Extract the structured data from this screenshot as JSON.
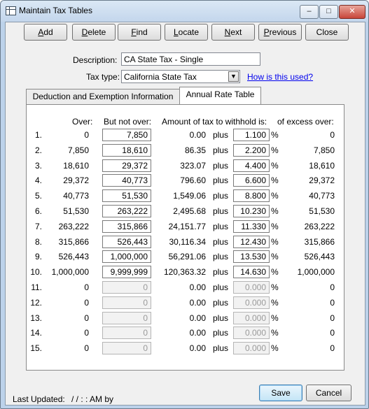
{
  "window": {
    "title": "Maintain Tax Tables"
  },
  "toolbar": {
    "buttons": [
      {
        "pre": "",
        "u": "A",
        "post": "dd"
      },
      {
        "pre": "",
        "u": "D",
        "post": "elete"
      },
      {
        "pre": "",
        "u": "F",
        "post": "ind"
      },
      {
        "pre": "",
        "u": "L",
        "post": "ocate"
      },
      {
        "pre": "",
        "u": "N",
        "post": "ext"
      },
      {
        "pre": "",
        "u": "P",
        "post": "revious"
      },
      {
        "pre": "Close",
        "u": "",
        "post": ""
      }
    ]
  },
  "form": {
    "description_label": "Description:",
    "description_value": "CA State Tax - Single",
    "taxtype_label": "Tax type:",
    "taxtype_value": "California State Tax",
    "help_link": "How is this used?"
  },
  "tabs": [
    "Deduction and Exemption Information",
    "Annual Rate Table"
  ],
  "table": {
    "headers": {
      "over": "Over:",
      "not_over": "But not over:",
      "amount": "Amount of tax to withhold is:",
      "excess": "of excess over:"
    },
    "rows": [
      {
        "n": "1.",
        "over": "0",
        "not_over": "7,850",
        "amount": "0.00",
        "plus": "plus",
        "rate": "1.100",
        "pct": "%",
        "excess": "0",
        "enabled": true
      },
      {
        "n": "2.",
        "over": "7,850",
        "not_over": "18,610",
        "amount": "86.35",
        "plus": "plus",
        "rate": "2.200",
        "pct": "%",
        "excess": "7,850",
        "enabled": true
      },
      {
        "n": "3.",
        "over": "18,610",
        "not_over": "29,372",
        "amount": "323.07",
        "plus": "plus",
        "rate": "4.400",
        "pct": "%",
        "excess": "18,610",
        "enabled": true
      },
      {
        "n": "4.",
        "over": "29,372",
        "not_over": "40,773",
        "amount": "796.60",
        "plus": "plus",
        "rate": "6.600",
        "pct": "%",
        "excess": "29,372",
        "enabled": true
      },
      {
        "n": "5.",
        "over": "40,773",
        "not_over": "51,530",
        "amount": "1,549.06",
        "plus": "plus",
        "rate": "8.800",
        "pct": "%",
        "excess": "40,773",
        "enabled": true
      },
      {
        "n": "6.",
        "over": "51,530",
        "not_over": "263,222",
        "amount": "2,495.68",
        "plus": "plus",
        "rate": "10.230",
        "pct": "%",
        "excess": "51,530",
        "enabled": true
      },
      {
        "n": "7.",
        "over": "263,222",
        "not_over": "315,866",
        "amount": "24,151.77",
        "plus": "plus",
        "rate": "11.330",
        "pct": "%",
        "excess": "263,222",
        "enabled": true
      },
      {
        "n": "8.",
        "over": "315,866",
        "not_over": "526,443",
        "amount": "30,116.34",
        "plus": "plus",
        "rate": "12.430",
        "pct": "%",
        "excess": "315,866",
        "enabled": true
      },
      {
        "n": "9.",
        "over": "526,443",
        "not_over": "1,000,000",
        "amount": "56,291.06",
        "plus": "plus",
        "rate": "13.530",
        "pct": "%",
        "excess": "526,443",
        "enabled": true
      },
      {
        "n": "10.",
        "over": "1,000,000",
        "not_over": "9,999,999",
        "amount": "120,363.32",
        "plus": "plus",
        "rate": "14.630",
        "pct": "%",
        "excess": "1,000,000",
        "enabled": true
      },
      {
        "n": "11.",
        "over": "0",
        "not_over": "0",
        "amount": "0.00",
        "plus": "plus",
        "rate": "0.000",
        "pct": "%",
        "excess": "0",
        "enabled": false
      },
      {
        "n": "12.",
        "over": "0",
        "not_over": "0",
        "amount": "0.00",
        "plus": "plus",
        "rate": "0.000",
        "pct": "%",
        "excess": "0",
        "enabled": false
      },
      {
        "n": "13.",
        "over": "0",
        "not_over": "0",
        "amount": "0.00",
        "plus": "plus",
        "rate": "0.000",
        "pct": "%",
        "excess": "0",
        "enabled": false
      },
      {
        "n": "14.",
        "over": "0",
        "not_over": "0",
        "amount": "0.00",
        "plus": "plus",
        "rate": "0.000",
        "pct": "%",
        "excess": "0",
        "enabled": false
      },
      {
        "n": "15.",
        "over": "0",
        "not_over": "0",
        "amount": "0.00",
        "plus": "plus",
        "rate": "0.000",
        "pct": "%",
        "excess": "0",
        "enabled": false
      }
    ]
  },
  "footer": {
    "last_updated_label": "Last Updated:",
    "last_updated_value": "/ /        : :  AM by",
    "save_label": "Save",
    "cancel_label": "Cancel"
  }
}
